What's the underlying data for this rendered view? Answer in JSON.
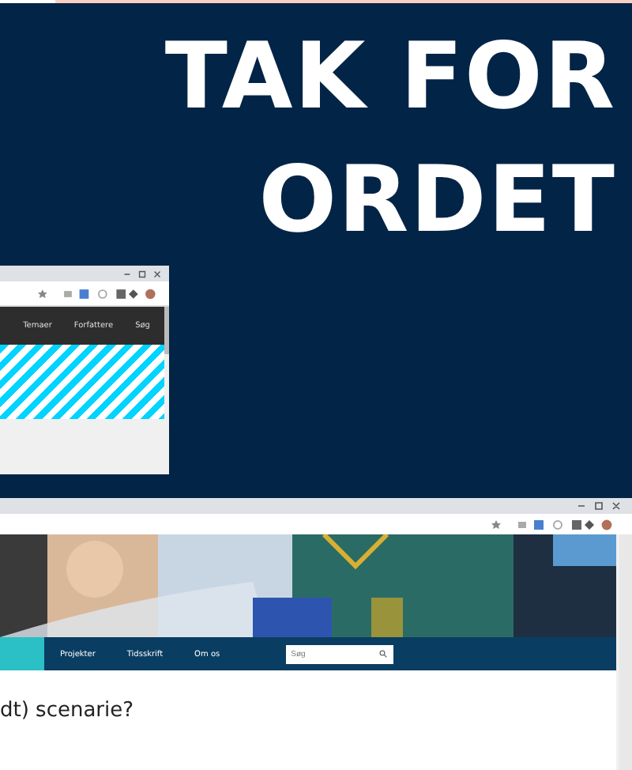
{
  "headline": [
    "TAK FOR",
    "ORDET"
  ],
  "small_window": {
    "nav_items": [
      "Temaer",
      "Forfattere",
      "Søg"
    ]
  },
  "large_window": {
    "tabs": [
      {
        "selected": true
      },
      {
        "label": "Projekter",
        "selected": false
      },
      {
        "label": "Tidsskrift",
        "selected": false
      },
      {
        "label": "Om os",
        "selected": false
      }
    ],
    "search": {
      "placeholder": "Søg"
    },
    "heading": "dt) scenarie?"
  }
}
